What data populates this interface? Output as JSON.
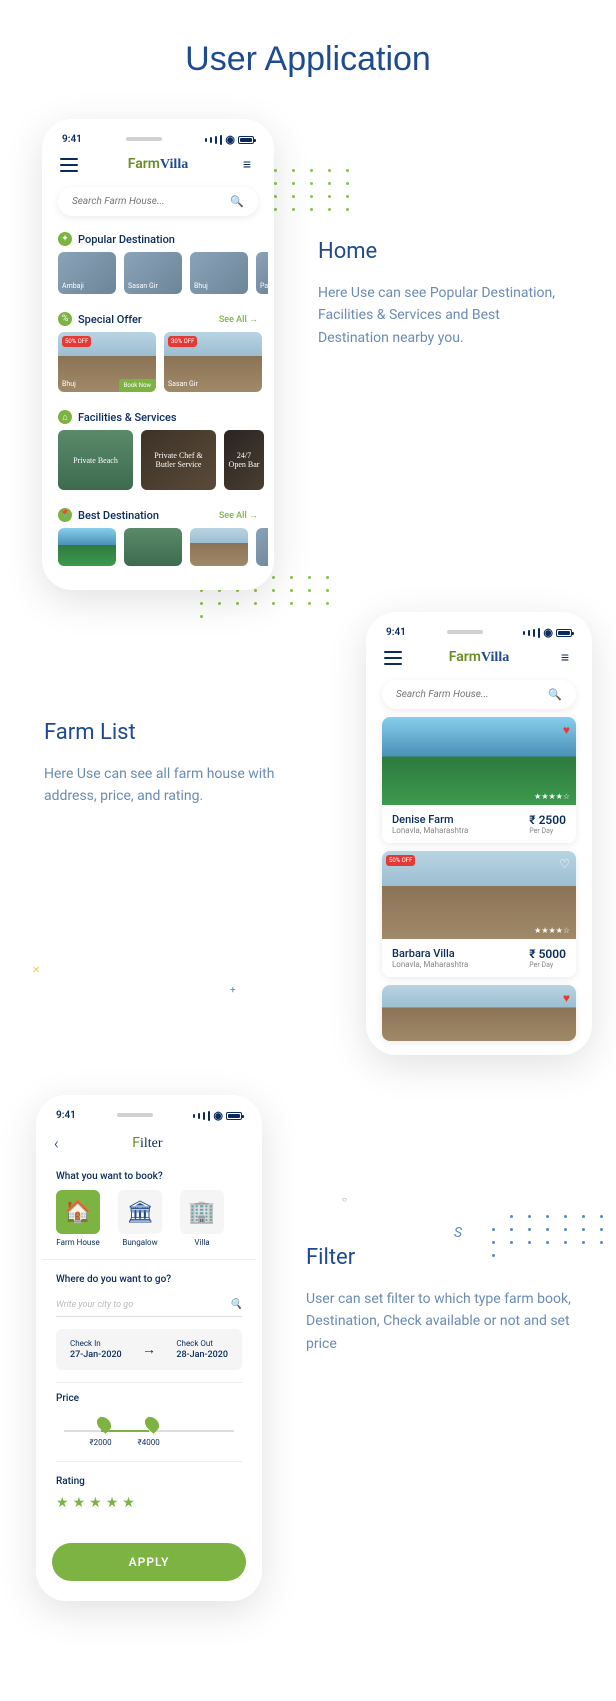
{
  "page_title": "User Application",
  "status_time": "9:41",
  "logo": {
    "farm": "Farm",
    "villa": "Villa"
  },
  "search_placeholder": "Search Farm House...",
  "home": {
    "title": "Home",
    "desc": "Here Use can see Popular Destination, Facilities & Services and Best Destination nearby you.",
    "popular": {
      "title": "Popular Destination",
      "items": [
        "Ambaji",
        "Sasan Gir",
        "Bhuj",
        "Pa"
      ]
    },
    "offer": {
      "title": "Special Offer",
      "see_all": "See All",
      "items": [
        {
          "tag": "50% OFF",
          "label": "Bhuj",
          "btn": "Book Now"
        },
        {
          "tag": "30% OFF",
          "label": "Sasan Gir"
        }
      ]
    },
    "facilities": {
      "title": "Facilities & Services",
      "items": [
        "Private Beach",
        "Private Chef & Butler Service",
        "24/7 Open Bar"
      ]
    },
    "best": {
      "title": "Best Destination",
      "see_all": "See All"
    }
  },
  "list": {
    "title": "Farm List",
    "desc": "Here Use can see all farm house with address, price, and rating.",
    "items": [
      {
        "name": "Denise Farm",
        "loc": "Lonavla, Maharashtra",
        "price": "₹ 2500",
        "per": "Per Day",
        "tag": ""
      },
      {
        "name": "Barbara Villa",
        "loc": "Lonavla, Maharashtra",
        "price": "₹ 5000",
        "per": "Per Day",
        "tag": "50% OFF"
      }
    ]
  },
  "filter": {
    "title": "Filter",
    "desc": "User can set filter to which type farm book, Destination, Check available or not and set price",
    "header": "Filter",
    "q1": "What you want to book?",
    "types": [
      "Farm House",
      "Bungalow",
      "Villa"
    ],
    "q2": "Where do you want to go?",
    "city_placeholder": "Write your city to go",
    "checkin_label": "Check In",
    "checkin": "27-Jan-2020",
    "checkout_label": "Check Out",
    "checkout": "28-Jan-2020",
    "price_label": "Price",
    "price_min": "₹2000",
    "price_max": "₹4000",
    "rating_label": "Rating",
    "apply": "APPLY"
  }
}
